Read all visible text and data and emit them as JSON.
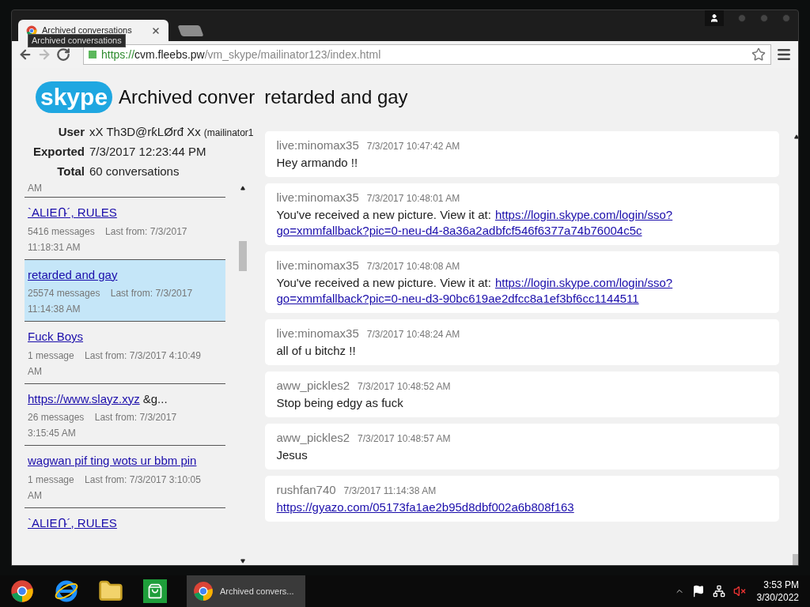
{
  "browser": {
    "tabs": [
      {
        "title": "Archived conversations",
        "selected": true
      },
      {
        "selected": false
      }
    ],
    "tooltip": "Archived conversations",
    "address": {
      "scheme": "https://",
      "host": "cvm.fleebs.pw",
      "path": "/vm_skype/mailinator123/index.html",
      "secure": true
    },
    "bookmarked": false
  },
  "page": {
    "logo": "skype",
    "title_parts": [
      "Archived conver",
      "retarded and gay"
    ],
    "info": [
      {
        "label": "User",
        "value": "xX Th3D@rƙLØrđ Xx",
        "note": "(mailinator1"
      },
      {
        "label": "Exported",
        "value": "7/3/2017 12:23:44 PM"
      },
      {
        "label": "Total",
        "value": "60 conversations"
      }
    ],
    "list_top_partial": "AM",
    "conversations": [
      {
        "name": "`ΑLIEՌ´, RULES",
        "count": "5416 messages",
        "last": "Last from: 7/3/2017 11:18:31 AM",
        "selected": false
      },
      {
        "name": "retarded and gay",
        "count": "25574 messages",
        "last": "Last from: 7/3/2017 11:14:38 AM",
        "selected": true
      },
      {
        "name": "Fuck Boys",
        "count": "1 message",
        "last": "Last from: 7/3/2017 4:10:49 AM",
        "selected": false
      },
      {
        "name": "https://www.slayz.xyz",
        "suffix": "&g...",
        "count": "26 messages",
        "last": "Last from: 7/3/2017 3:15:45 AM",
        "selected": false
      },
      {
        "name": "wagwan pif ting wots ur bbm pin",
        "count": "1 message",
        "last": "Last from: 7/3/2017 3:10:05 AM",
        "selected": false
      },
      {
        "name": "`ΑLIEՌ´, RULES",
        "selected": false
      }
    ],
    "messages": [
      {
        "sender": "live:minomax35",
        "time": "7/3/2017 10:47:42 AM",
        "text": "Hey armando !!"
      },
      {
        "sender": "live:minomax35",
        "time": "7/3/2017 10:48:01 AM",
        "text": "You've received a new picture. View it at:",
        "link_lines": [
          "https://login.skype.com/login/sso?",
          "go=xmmfallback?pic=0-neu-d4-8a36a2adbfcf546f6377a74b76004c5c"
        ]
      },
      {
        "sender": "live:minomax35",
        "time": "7/3/2017 10:48:08 AM",
        "text": "You've received a new picture. View it at:",
        "link_lines": [
          "https://login.skype.com/login/sso?",
          "go=xmmfallback?pic=0-neu-d3-90bc619ae2dfcc8a1ef3bf6cc1144511"
        ]
      },
      {
        "sender": "live:minomax35",
        "time": "7/3/2017 10:48:24 AM",
        "text": "all of u bitchz !!"
      },
      {
        "sender": "aww_pickles2",
        "time": "7/3/2017 10:48:52 AM",
        "text": "Stop being edgy as fuck"
      },
      {
        "sender": "aww_pickles2",
        "time": "7/3/2017 10:48:57 AM",
        "text": "Jesus"
      },
      {
        "sender": "rushfan740",
        "time": "7/3/2017 11:14:38 AM",
        "link_lines": [
          "https://gyazo.com/05173fa1ae2b95d8dbf002a6b808f163"
        ]
      }
    ]
  },
  "taskbar": {
    "apps": [
      {
        "kind": "chrome"
      },
      {
        "kind": "ie"
      },
      {
        "kind": "folder"
      },
      {
        "kind": "store"
      }
    ],
    "tasks": [
      {
        "title": "Archived convers...",
        "selected": true
      }
    ],
    "tray": {
      "volume_muted": true
    },
    "time": "3:53 PM",
    "date": "3/30/2022"
  }
}
